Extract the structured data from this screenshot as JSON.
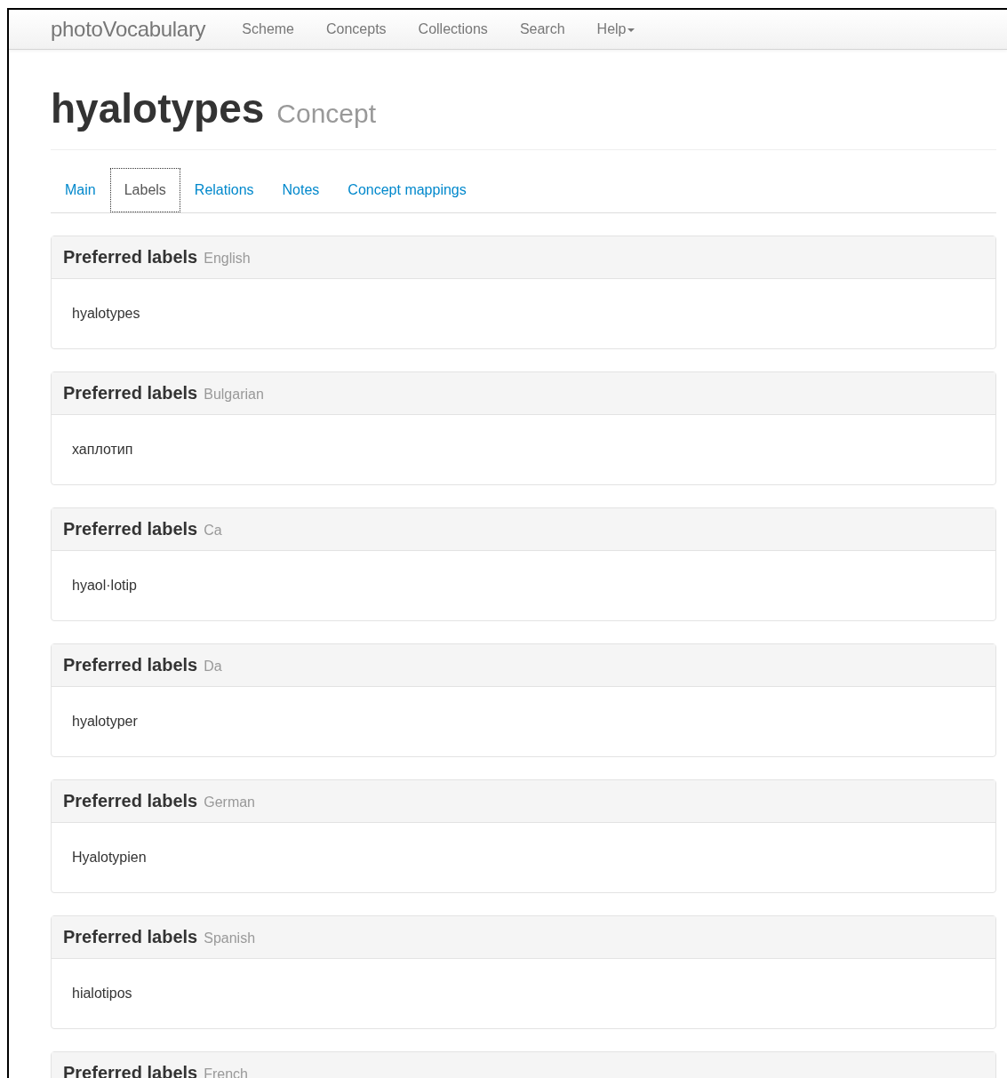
{
  "navbar": {
    "brand": "photoVocabulary",
    "items": [
      {
        "label": "Scheme",
        "dropdown": false
      },
      {
        "label": "Concepts",
        "dropdown": false
      },
      {
        "label": "Collections",
        "dropdown": false
      },
      {
        "label": "Search",
        "dropdown": false
      },
      {
        "label": "Help",
        "dropdown": true
      }
    ]
  },
  "heading": {
    "title": "hyalotypes",
    "subtitle": "Concept"
  },
  "tabs": [
    {
      "label": "Main",
      "selected": false
    },
    {
      "label": "Labels",
      "selected": true
    },
    {
      "label": "Relations",
      "selected": false
    },
    {
      "label": "Notes",
      "selected": false
    },
    {
      "label": "Concept mappings",
      "selected": false
    }
  ],
  "panels": [
    {
      "title": "Preferred labels",
      "language": "English",
      "value": "hyalotypes"
    },
    {
      "title": "Preferred labels",
      "language": "Bulgarian",
      "value": "хаплотип"
    },
    {
      "title": "Preferred labels",
      "language": "Ca",
      "value": "hyaol·lotip"
    },
    {
      "title": "Preferred labels",
      "language": "Da",
      "value": "hyalotyper"
    },
    {
      "title": "Preferred labels",
      "language": "German",
      "value": "Hyalotypien"
    },
    {
      "title": "Preferred labels",
      "language": "Spanish",
      "value": "hialotipos"
    },
    {
      "title": "Preferred labels",
      "language": "French"
    }
  ]
}
